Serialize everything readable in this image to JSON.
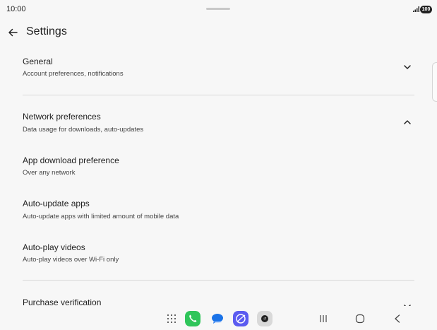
{
  "status_bar": {
    "time": "10:00",
    "battery": "100"
  },
  "header": {
    "title": "Settings"
  },
  "general": {
    "title": "General",
    "subtitle": "Account preferences, notifications"
  },
  "network": {
    "title": "Network preferences",
    "subtitle": "Data usage for downloads, auto-updates"
  },
  "app_download": {
    "title": "App download preference",
    "subtitle": "Over any network"
  },
  "auto_update": {
    "title": "Auto-update apps",
    "subtitle": "Auto-update apps with limited amount of mobile data"
  },
  "auto_play": {
    "title": "Auto-play videos",
    "subtitle": "Auto-play videos over Wi-Fi only"
  },
  "purchase": {
    "title": "Purchase verification"
  },
  "dock": {
    "apps": [
      "app-drawer",
      "phone",
      "messages",
      "internet",
      "camera"
    ],
    "colors": {
      "phone": "#2fc55a",
      "messages": "#1a73e8",
      "internet": "#5b5bf0",
      "camera": "#d9d9d9"
    }
  }
}
